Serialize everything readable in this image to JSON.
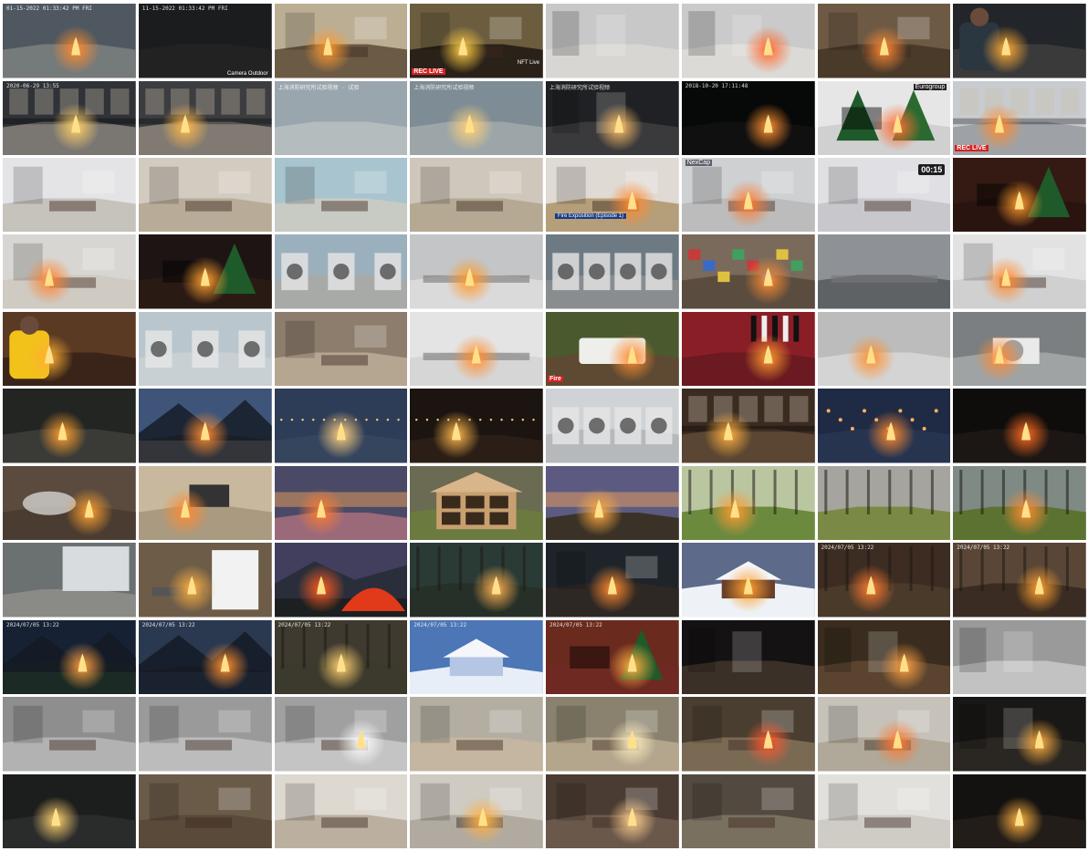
{
  "grid": {
    "columns": 8,
    "rows": 11
  },
  "overlays": {
    "t0_stamp": "01-15-2022 01:33:42 PM FRI",
    "t1_stamp": "11-15-2022 01:33:42 PM FRI",
    "t1_cam": "Camera Outdoor",
    "t3_badge": "REC LIVE",
    "t3_side": "NFT Live",
    "t8_stamp": "2020-06-29 13:55",
    "t10_stamp": "上海消防研究所试验视频 · 试验",
    "t11_stamp": "上海消防研究所试验视频",
    "t12_stamp": "上海消防研究所试验视频",
    "t13_stamp": "2018-10-20 17:11:48",
    "t14_badge": "Eurogroup",
    "t15_badge": "REC LIVE",
    "t20_label": "Fire Exposition (Episode 1)",
    "t21_tag": "NexCap",
    "t22_timer": "00:15",
    "t36_badge": "Fire",
    "t62_stamp": "2024/07/05 13:22",
    "t63_stamp": "2024/07/05 13:22",
    "t64_stamp": "2024/07/05 13:22",
    "t65_stamp": "2024/07/05 13:22",
    "t66_stamp": "2024/07/05 13:22",
    "t67_stamp": "2024/07/05 13:22",
    "t68_stamp": "2024/07/05 13:22"
  },
  "tiles": [
    {
      "bg": "#4f5860",
      "floor": "#757a7a",
      "fire": true,
      "ftone": "#ff8a2a",
      "scene": "garage"
    },
    {
      "bg": "#1b1c1d",
      "floor": "#222",
      "fire": false,
      "scene": "dark"
    },
    {
      "bg": "#bcae93",
      "floor": "#6b5a44",
      "fire": true,
      "ftone": "#ff9a30",
      "scene": "living"
    },
    {
      "bg": "#6c5d3f",
      "floor": "#2a2219",
      "fire": true,
      "ftone": "#ffcc44",
      "scene": "living-dark"
    },
    {
      "bg": "#c8c8c8",
      "floor": "#d8d6d2",
      "fire": false,
      "scene": "hall"
    },
    {
      "bg": "#cacaca",
      "floor": "#dcdad6",
      "fire": true,
      "ftone": "#ff6a30",
      "scene": "hall"
    },
    {
      "bg": "#6e5a44",
      "floor": "#4a3a2a",
      "fire": true,
      "ftone": "#ff8833",
      "scene": "cabin"
    },
    {
      "bg": "#22262a",
      "floor": "#3a3a3a",
      "fire": true,
      "ftone": "#ffaa33",
      "scene": "person"
    },
    {
      "bg": "#2f3236",
      "floor": "#7a7672",
      "fire": true,
      "ftone": "#ffcf66",
      "scene": "kitchen"
    },
    {
      "bg": "#3b3d40",
      "floor": "#807a72",
      "fire": true,
      "ftone": "#ffb84c",
      "scene": "kitchen"
    },
    {
      "bg": "#9aa6ae",
      "floor": "#b4bcbe",
      "fire": false,
      "scene": "room-cctv"
    },
    {
      "bg": "#7d8c95",
      "floor": "#9ca6a8",
      "fire": true,
      "ftone": "#ffd07a",
      "scene": "room-cctv"
    },
    {
      "bg": "#1f2124",
      "floor": "#3a3a3c",
      "fire": true,
      "ftone": "#ffc067",
      "scene": "dark-hall"
    },
    {
      "bg": "#070808",
      "floor": "#101010",
      "fire": true,
      "ftone": "#ff8f30",
      "scene": "dark"
    },
    {
      "bg": "#e6e6e6",
      "floor": "#d0d0d0",
      "fire": true,
      "ftone": "#ff6c30",
      "scene": "trees"
    },
    {
      "bg": "#c8ccd0",
      "floor": "#9ea2a6",
      "fire": true,
      "ftone": "#ff8b30",
      "scene": "kitchen-light"
    },
    {
      "bg": "#e4e4e6",
      "floor": "#c6c2bc",
      "fire": false,
      "scene": "room-white"
    },
    {
      "bg": "#d2cbbf",
      "floor": "#b8ab98",
      "fire": false,
      "scene": "room-warm"
    },
    {
      "bg": "#a8c4cf",
      "floor": "#c8cbc4",
      "fire": false,
      "scene": "nursery"
    },
    {
      "bg": "#cfc7bc",
      "floor": "#b6a994",
      "fire": false,
      "scene": "room-warm"
    },
    {
      "bg": "#e0dad4",
      "floor": "#b59e7a",
      "fire": true,
      "ftone": "#ff8a30",
      "scene": "office"
    },
    {
      "bg": "#ced0d2",
      "floor": "#bcbcbc",
      "fire": true,
      "ftone": "#ff7a30",
      "scene": "desk"
    },
    {
      "bg": "#e0e0e4",
      "floor": "#c8c8cc",
      "fire": false,
      "scene": "room-white"
    },
    {
      "bg": "#341a12",
      "floor": "#2a1410",
      "fire": true,
      "ftone": "#ff9a2c",
      "scene": "xmas"
    },
    {
      "bg": "#d8d6d2",
      "floor": "#cfcac2",
      "fire": true,
      "ftone": "#ff8430",
      "scene": "room-white"
    },
    {
      "bg": "#1e1414",
      "floor": "#2a1a14",
      "fire": true,
      "ftone": "#ffa030",
      "scene": "xmas"
    },
    {
      "bg": "#9bb0bd",
      "floor": "#a7aaa7",
      "fire": false,
      "scene": "laundry"
    },
    {
      "bg": "#c3c5c6",
      "floor": "#dadada",
      "fire": true,
      "ftone": "#ff9a2a",
      "scene": "table"
    },
    {
      "bg": "#6d7a83",
      "floor": "#8a8d8f",
      "fire": false,
      "scene": "washers"
    },
    {
      "bg": "#7a6a5b",
      "floor": "#5a4c3e",
      "fire": true,
      "ftone": "#ff8c30",
      "scene": "cluttered"
    },
    {
      "bg": "#8e9296",
      "floor": "#5e6264",
      "fire": false,
      "scene": "lab"
    },
    {
      "bg": "#e2e2e2",
      "floor": "#d0d0d0",
      "fire": true,
      "ftone": "#ff8a30",
      "scene": "room-white"
    },
    {
      "bg": "#5b3a24",
      "floor": "#3a241a",
      "fire": true,
      "ftone": "#ffb030",
      "scene": "person-yellow"
    },
    {
      "bg": "#b9c6ce",
      "floor": "#c8d0d4",
      "fire": false,
      "scene": "laundry"
    },
    {
      "bg": "#8c7d6c",
      "floor": "#b5a692",
      "fire": false,
      "scene": "living"
    },
    {
      "bg": "#e4e4e4",
      "floor": "#d6d6d6",
      "fire": true,
      "ftone": "#ff8f30",
      "scene": "lab-white"
    },
    {
      "bg": "#4a5a2e",
      "floor": "#5e4a32",
      "fire": true,
      "ftone": "#ff8c30",
      "scene": "mattress"
    },
    {
      "bg": "#8a1e26",
      "floor": "#6a1a20",
      "fire": true,
      "ftone": "#ff9a30",
      "scene": "sofa-red"
    },
    {
      "bg": "#bcbcbc",
      "floor": "#d4d4d4",
      "fire": true,
      "ftone": "#ff9030",
      "scene": "snow"
    },
    {
      "bg": "#7b7f81",
      "floor": "#9fa3a4",
      "fire": true,
      "ftone": "#ff8a30",
      "scene": "ac-unit"
    },
    {
      "bg": "#232522",
      "floor": "#3a3b36",
      "fire": true,
      "ftone": "#ffa030",
      "scene": "night-yard"
    },
    {
      "bg": "#3e5579",
      "floor": "#33353a",
      "fire": true,
      "ftone": "#ff8a30",
      "scene": "lake"
    },
    {
      "bg": "#2e3d57",
      "floor": "#36455e",
      "fire": true,
      "ftone": "#ffd080",
      "scene": "night-road"
    },
    {
      "bg": "#1b1410",
      "floor": "#2a1e16",
      "fire": true,
      "ftone": "#ffb84c",
      "scene": "city-night"
    },
    {
      "bg": "#d0d3d6",
      "floor": "#b6b9bc",
      "fire": false,
      "scene": "washers"
    },
    {
      "bg": "#3b2c22",
      "floor": "#5a4632",
      "fire": true,
      "ftone": "#ffb040",
      "scene": "kitchen-warm"
    },
    {
      "bg": "#1f2a45",
      "floor": "#273450",
      "fire": true,
      "ftone": "#ff8a30",
      "scene": "diorama"
    },
    {
      "bg": "#0f0d0c",
      "floor": "#1c1714",
      "fire": true,
      "ftone": "#ff6a20",
      "scene": "dark"
    },
    {
      "bg": "#5a4b3e",
      "floor": "#4a3c30",
      "fire": true,
      "ftone": "#ffa030",
      "scene": "smoke"
    },
    {
      "bg": "#c8b99e",
      "floor": "#aa9a80",
      "fire": true,
      "ftone": "#ff8a30",
      "scene": "socket"
    },
    {
      "bg": "#4b4a66",
      "floor": "#9a6a7a",
      "fire": true,
      "ftone": "#ff7a30",
      "scene": "lantern"
    },
    {
      "bg": "#6b6a52",
      "floor": "#6b7a3e",
      "fire": false,
      "scene": "dollhouse"
    },
    {
      "bg": "#5c5a80",
      "floor": "#3a3226",
      "fire": true,
      "ftone": "#ffaa40",
      "scene": "sunset"
    },
    {
      "bg": "#b9c6a0",
      "floor": "#6c8a3e",
      "fire": true,
      "ftone": "#ff9a30",
      "scene": "trash-can"
    },
    {
      "bg": "#a6a49e",
      "floor": "#7a8a44",
      "fire": false,
      "scene": "yard"
    },
    {
      "bg": "#7f8a84",
      "floor": "#5c7230",
      "fire": true,
      "ftone": "#ff8a30",
      "scene": "yard-fire"
    },
    {
      "bg": "#6b7070",
      "floor": "#8a8a86",
      "fire": false,
      "scene": "street"
    },
    {
      "bg": "#6c5c48",
      "floor": "#6e5c48",
      "fire": true,
      "ftone": "#ffb040",
      "scene": "grill"
    },
    {
      "bg": "#413e5e",
      "floor": "#1c2020",
      "fire": true,
      "ftone": "#ff5a20",
      "scene": "tent"
    },
    {
      "bg": "#2a3a34",
      "floor": "#263028",
      "fire": true,
      "ftone": "#ffb050",
      "scene": "camp"
    },
    {
      "bg": "#1e242a",
      "floor": "#2e2824",
      "fire": true,
      "ftone": "#ff8a30",
      "scene": "modern"
    },
    {
      "bg": "#5e6a8a",
      "floor": "#eef2f6",
      "fire": true,
      "ftone": "#ffa030",
      "scene": "snow-cabin"
    },
    {
      "bg": "#3c2c22",
      "floor": "#4a3a2a",
      "fire": true,
      "ftone": "#ff7a30",
      "scene": "forest"
    },
    {
      "bg": "#5a4636",
      "floor": "#3a2c22",
      "fire": true,
      "ftone": "#ffa030",
      "scene": "woodfire"
    },
    {
      "bg": "#162234",
      "floor": "#1b2a24",
      "fire": true,
      "ftone": "#ffa040",
      "scene": "camp-night"
    },
    {
      "bg": "#2a3850",
      "floor": "#1a2230",
      "fire": true,
      "ftone": "#ff9030",
      "scene": "lake"
    },
    {
      "bg": "#3e3a30",
      "floor": "#3b3a2c",
      "fire": true,
      "ftone": "#ffd070",
      "scene": "camp"
    },
    {
      "bg": "#4c76b5",
      "floor": "#e8eef8",
      "fire": false,
      "scene": "snow-field"
    },
    {
      "bg": "#6a2a1e",
      "floor": "#6e2a22",
      "fire": true,
      "ftone": "#ffb040",
      "scene": "xmas-room"
    },
    {
      "bg": "#141212",
      "floor": "#3a3028",
      "fire": false,
      "scene": "hall-dark"
    },
    {
      "bg": "#3a2c1e",
      "floor": "#5a4430",
      "fire": true,
      "ftone": "#ffa040",
      "scene": "hall-dark"
    },
    {
      "bg": "#9a9a9a",
      "floor": "#c2c2c2",
      "fire": false,
      "scene": "hall-gray"
    },
    {
      "bg": "#8e8e8e",
      "floor": "#b2b2b2",
      "fire": false,
      "scene": "office-gray"
    },
    {
      "bg": "#9a9a9a",
      "floor": "#bcbcbc",
      "fire": false,
      "scene": "office-gray"
    },
    {
      "bg": "#a0a0a0",
      "floor": "#c4c4c4",
      "fire": true,
      "ftone": "#ffffff",
      "scene": "office-gray"
    },
    {
      "bg": "#b4aea2",
      "floor": "#c4b6a0",
      "fire": false,
      "scene": "bedroom"
    },
    {
      "bg": "#8a826e",
      "floor": "#b4a68c",
      "fire": true,
      "ftone": "#fff0c0",
      "scene": "bedroom"
    },
    {
      "bg": "#4a3e30",
      "floor": "#7a6a54",
      "fire": true,
      "ftone": "#ff5a30",
      "scene": "living-dark"
    },
    {
      "bg": "#c6c2ba",
      "floor": "#b0a898",
      "fire": true,
      "ftone": "#ff7a30",
      "scene": "dining"
    },
    {
      "bg": "#1a1816",
      "floor": "#2a2622",
      "fire": true,
      "ftone": "#ffb040",
      "scene": "hall-dark"
    },
    {
      "bg": "#1c1e1e",
      "floor": "#2a2c2c",
      "fire": true,
      "ftone": "#ffd070",
      "scene": "dark"
    },
    {
      "bg": "#6a5a48",
      "floor": "#5a4a3a",
      "fire": false,
      "scene": "living"
    },
    {
      "bg": "#ddd8d0",
      "floor": "#bbb0a0",
      "fire": false,
      "scene": "room-warm"
    },
    {
      "bg": "#cfcac2",
      "floor": "#b0aaa0",
      "fire": true,
      "ftone": "#ffb040",
      "scene": "room-warm"
    },
    {
      "bg": "#4a3c32",
      "floor": "#6a584a",
      "fire": true,
      "ftone": "#ffd090",
      "scene": "bedroom"
    },
    {
      "bg": "#524a40",
      "floor": "#7a7060",
      "fire": false,
      "scene": "living-dark"
    },
    {
      "bg": "#e2e0dc",
      "floor": "#cfccc6",
      "fire": false,
      "scene": "room-white"
    },
    {
      "bg": "#141211",
      "floor": "#221d18",
      "fire": true,
      "ftone": "#ffb040",
      "scene": "dark"
    }
  ]
}
